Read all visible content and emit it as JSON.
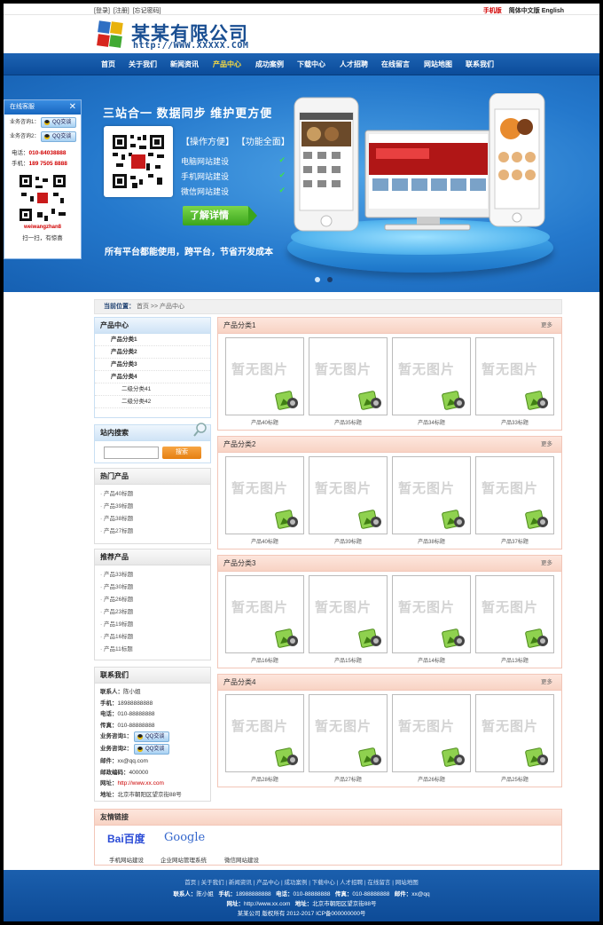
{
  "topbar": {
    "login": "[登录]",
    "register": "[注册]",
    "forgot": "[忘记密码]",
    "mobile": "手机版",
    "lang": "简体中文版",
    "english": "English"
  },
  "header": {
    "company": "某某有限公司",
    "url": "http://WWW.XXXXX.COM"
  },
  "nav": [
    {
      "label": "首页"
    },
    {
      "label": "关于我们"
    },
    {
      "label": "新闻资讯"
    },
    {
      "label": "产品中心"
    },
    {
      "label": "成功案例"
    },
    {
      "label": "下载中心"
    },
    {
      "label": "人才招聘"
    },
    {
      "label": "在线留言"
    },
    {
      "label": "网站地图"
    },
    {
      "label": "联系我们"
    }
  ],
  "banner": {
    "title": "三站合一  数据同步  维护更方便",
    "tags": "【操作方便】  【功能全面】",
    "features": [
      "电脑网站建设",
      "手机网站建设",
      "微信网站建设"
    ],
    "check": "✔",
    "button": "了解详情",
    "caption": "所有平台都能使用，跨平台，节省开发成本"
  },
  "service": {
    "title": "在线客服",
    "close": "✕",
    "consult1": "业务咨询1：",
    "consult2": "业务咨询2：",
    "qq": "QQ交谈",
    "tel_label": "电话：",
    "tel": "010-84038888",
    "mobile_label": "手机：",
    "mobile": "189 7505 8888",
    "wechat": "weiwangzhan8",
    "scan": "扫一扫，有惊喜"
  },
  "breadcrumb": {
    "label": "当前位置：",
    "home": "首页",
    "sep": ">>",
    "current": "产品中心"
  },
  "sidebar": {
    "cat_title": "产品中心",
    "cats": [
      "产品分类1",
      "产品分类2",
      "产品分类3",
      "产品分类4"
    ],
    "subcats": [
      "二级分类41",
      "二级分类42"
    ],
    "search_title": "站内搜索",
    "search_btn": "搜索",
    "hot_title": "热门产品",
    "hot": [
      "产品40标题",
      "产品39标题",
      "产品38标题",
      "产品27标题"
    ],
    "rec_title": "推荐产品",
    "rec": [
      "产品33标题",
      "产品30标题",
      "产品26标题",
      "产品23标题",
      "产品19标题",
      "产品16标题",
      "产品11标题"
    ],
    "contact_title": "联系我们",
    "contact": {
      "person_l": "联系人：",
      "person": "陈小姐",
      "mobile_l": "手机：",
      "mobile": "18988888888",
      "tel_l": "电话：",
      "tel": "010-88888888",
      "fax_l": "传真：",
      "fax": "010-88888888",
      "c1_l": "业务咨询1：",
      "c2_l": "业务咨询2：",
      "qq": "QQ交谈",
      "mail_l": "邮件：",
      "mail": "xx@qq.com",
      "zip_l": "邮政编码：",
      "zip": "400000",
      "web_l": "网址：",
      "web": "http://www.xx.com",
      "addr_l": "地址：",
      "addr": "北京市朝阳区望京街88号"
    }
  },
  "products": {
    "more": "更多",
    "noimg": "暂无图片",
    "blocks": [
      {
        "title": "产品分类1",
        "items": [
          "产品40标题",
          "产品35标题",
          "产品34标题",
          "产品33标题"
        ]
      },
      {
        "title": "产品分类2",
        "items": [
          "产品40标题",
          "产品39标题",
          "产品38标题",
          "产品37标题"
        ]
      },
      {
        "title": "产品分类3",
        "items": [
          "产品16标题",
          "产品15标题",
          "产品14标题",
          "产品13标题"
        ]
      },
      {
        "title": "产品分类4",
        "items": [
          "产品28标题",
          "产品27标题",
          "产品26标题",
          "产品25标题"
        ]
      }
    ]
  },
  "links": {
    "title": "友情链接",
    "baidu": "Bai百度",
    "google": "Google",
    "items": [
      "手机网站建设",
      "企业网站管理系统",
      "微信网站建设"
    ]
  },
  "footer": {
    "nav": "首页  |  关于我们  |  新闻资讯  |  产品中心  |  成功案例  |  下载中心  |  人才招聘  |  在线留言  |  网站地图",
    "contact_person_l": "联系人：",
    "contact_person": "陈小姐",
    "mobile_l": "手机：",
    "mobile": "18988888888",
    "tel_l": "电话：",
    "tel": "010-88888888",
    "fax_l": "传真：",
    "fax": "010-88888888",
    "mail_l": "邮件：",
    "mail": "xx@qq",
    "web_l": "网址：",
    "web": "http://www.xx.com",
    "addr_l": "地址：",
    "addr": "北京市朝阳区望京街88号",
    "copyright": "某某公司  版权所有 2012-2017  ICP备000000000号"
  },
  "colors": {
    "nav": "#1d63b3",
    "active_nav": "#ffde3d",
    "accent_red": "#d20000",
    "product_header": "#f8d3c4"
  }
}
